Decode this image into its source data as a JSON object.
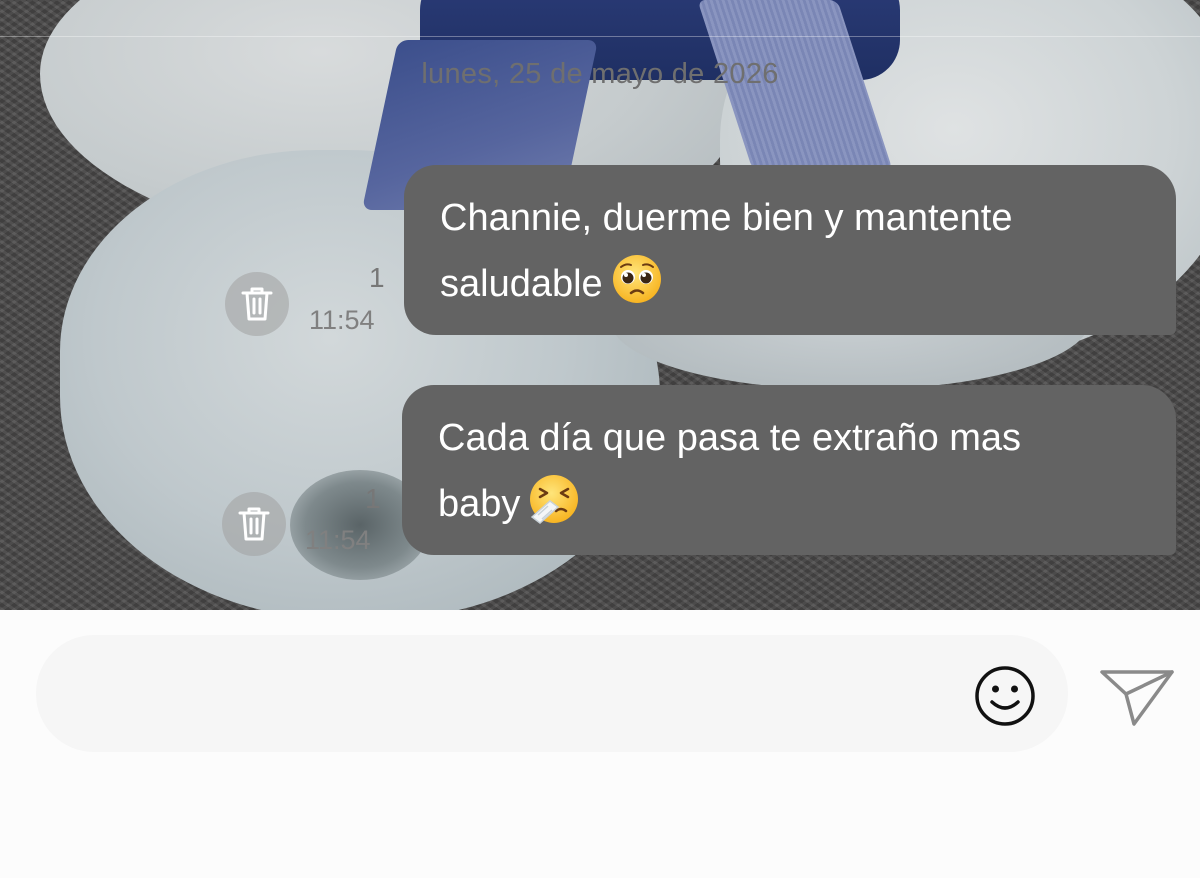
{
  "chat": {
    "date_separator": "lunes, 25 de mayo de 2026",
    "messages": [
      {
        "line1": "Channie, duerme bien y mantente",
        "line2": "saludable",
        "emoji": "pleading-face-emoji",
        "read_count": "1",
        "time": "11:54",
        "delete_icon": "trash-icon"
      },
      {
        "line1": "Cada día que pasa te extraño mas",
        "line2": "baby",
        "emoji": "sneezing-face-emoji",
        "read_count": "1",
        "time": "11:54",
        "delete_icon": "trash-icon"
      }
    ]
  },
  "composer": {
    "placeholder": "",
    "emoji_icon": "smiley-icon",
    "send_icon": "paper-plane-icon"
  },
  "colors": {
    "bubble": "#636363",
    "bubble_text": "#ffffff",
    "meta_text": "#7a7a7a",
    "composer_bg": "#fcfcfc",
    "input_bg": "#f6f6f6"
  }
}
